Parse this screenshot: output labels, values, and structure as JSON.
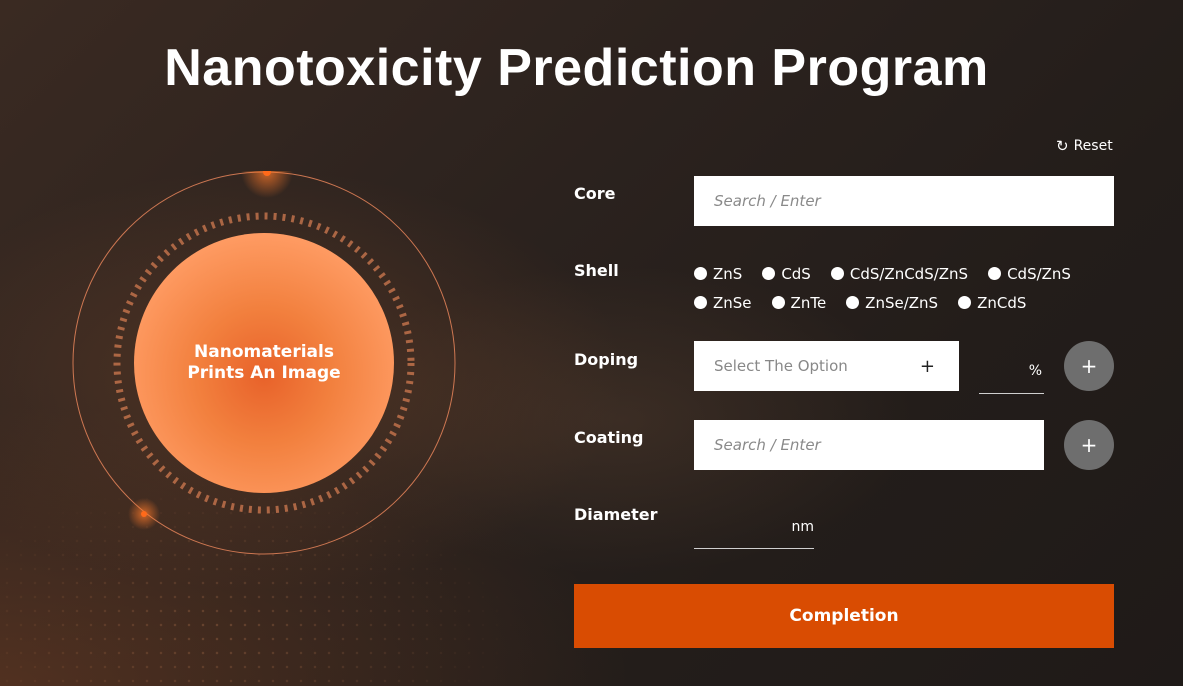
{
  "title": "Nanotoxicity Prediction Program",
  "visual": {
    "line1": "Nanomaterials",
    "line2": "Prints An Image"
  },
  "reset_label": "Reset",
  "form": {
    "core": {
      "label": "Core",
      "placeholder": "Search / Enter"
    },
    "shell": {
      "label": "Shell",
      "options_row1": [
        "ZnS",
        "CdS",
        "CdS/ZnCdS/ZnS",
        "CdS/ZnS"
      ],
      "options_row2": [
        "ZnSe",
        "ZnTe",
        "ZnSe/ZnS",
        "ZnCdS"
      ]
    },
    "doping": {
      "label": "Doping",
      "select_text": "Select The Option",
      "select_icon": "+",
      "unit": "%",
      "add_icon": "+"
    },
    "coating": {
      "label": "Coating",
      "placeholder": "Search / Enter",
      "add_icon": "+"
    },
    "diameter": {
      "label": "Diameter",
      "unit": "nm"
    }
  },
  "submit_label": "Completion",
  "colors": {
    "accent": "#d94c02",
    "core_orange": "#f2803e",
    "button_gray": "#6e6e6e"
  }
}
